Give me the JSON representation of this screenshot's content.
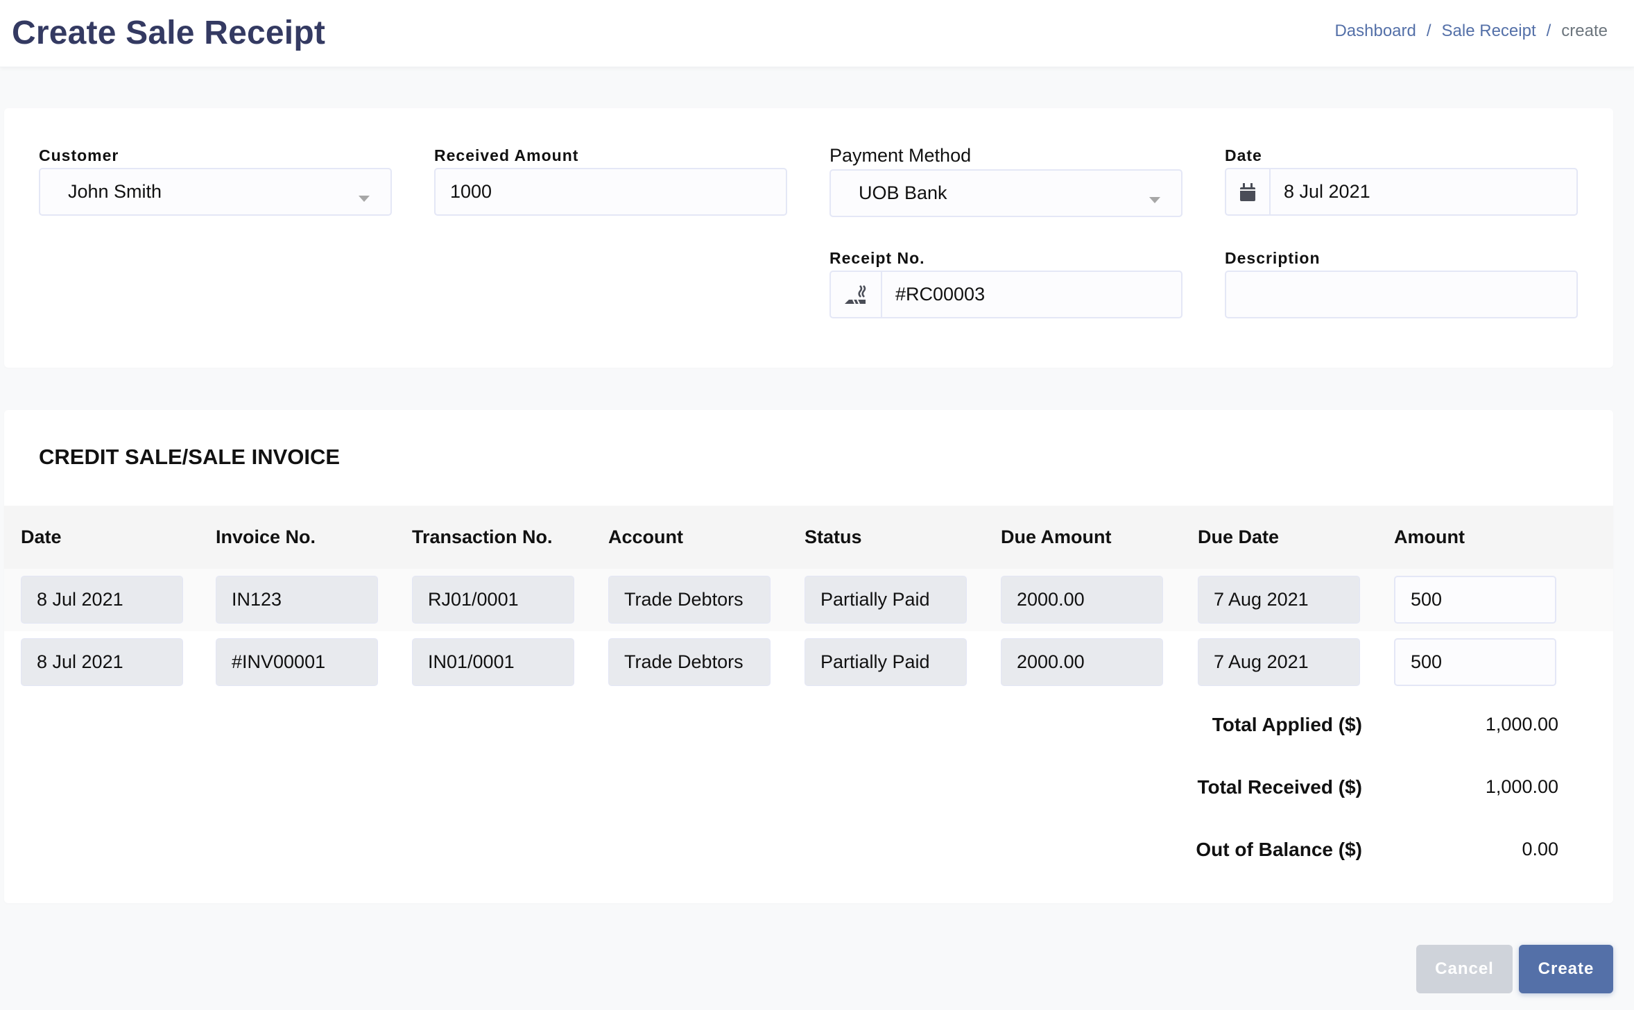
{
  "header": {
    "title": "Create Sale Receipt",
    "breadcrumb": [
      "Dashboard",
      "Sale Receipt",
      "create"
    ],
    "breadcrumb_separator": "/"
  },
  "form": {
    "customer": {
      "label": "Customer",
      "value": "John Smith"
    },
    "received_amount": {
      "label": "Received Amount",
      "value": "1000"
    },
    "payment_method": {
      "label": "Payment Method",
      "value": "UOB Bank"
    },
    "date": {
      "label": "Date",
      "value": "8 Jul 2021",
      "icon": "calendar-icon"
    },
    "receipt_no": {
      "label": "Receipt No.",
      "value": "#RC00003",
      "icon": "smoking-icon"
    },
    "description": {
      "label": "Description",
      "value": ""
    }
  },
  "invoices": {
    "title": "CREDIT SALE/SALE INVOICE",
    "columns": [
      "Date",
      "Invoice No.",
      "Transaction No.",
      "Account",
      "Status",
      "Due Amount",
      "Due Date",
      "Amount"
    ],
    "rows": [
      [
        "8 Jul 2021",
        "IN123",
        "RJ01/0001",
        "Trade Debtors",
        "Partially Paid",
        "2000.00",
        "7 Aug 2021",
        "500"
      ],
      [
        "8 Jul 2021",
        "#INV00001",
        "IN01/0001",
        "Trade Debtors",
        "Partially Paid",
        "2000.00",
        "7 Aug 2021",
        "500"
      ]
    ],
    "totals": [
      {
        "label": "Total Applied ($)",
        "value": "1,000.00"
      },
      {
        "label": "Total Received ($)",
        "value": "1,000.00"
      },
      {
        "label": "Out of Balance ($)",
        "value": "0.00"
      }
    ]
  },
  "actions": {
    "cancel_label": "Cancel",
    "create_label": "Create"
  },
  "colors": {
    "primary": "#5470a8",
    "title": "#343a62",
    "cancel": "#cfd3da"
  }
}
